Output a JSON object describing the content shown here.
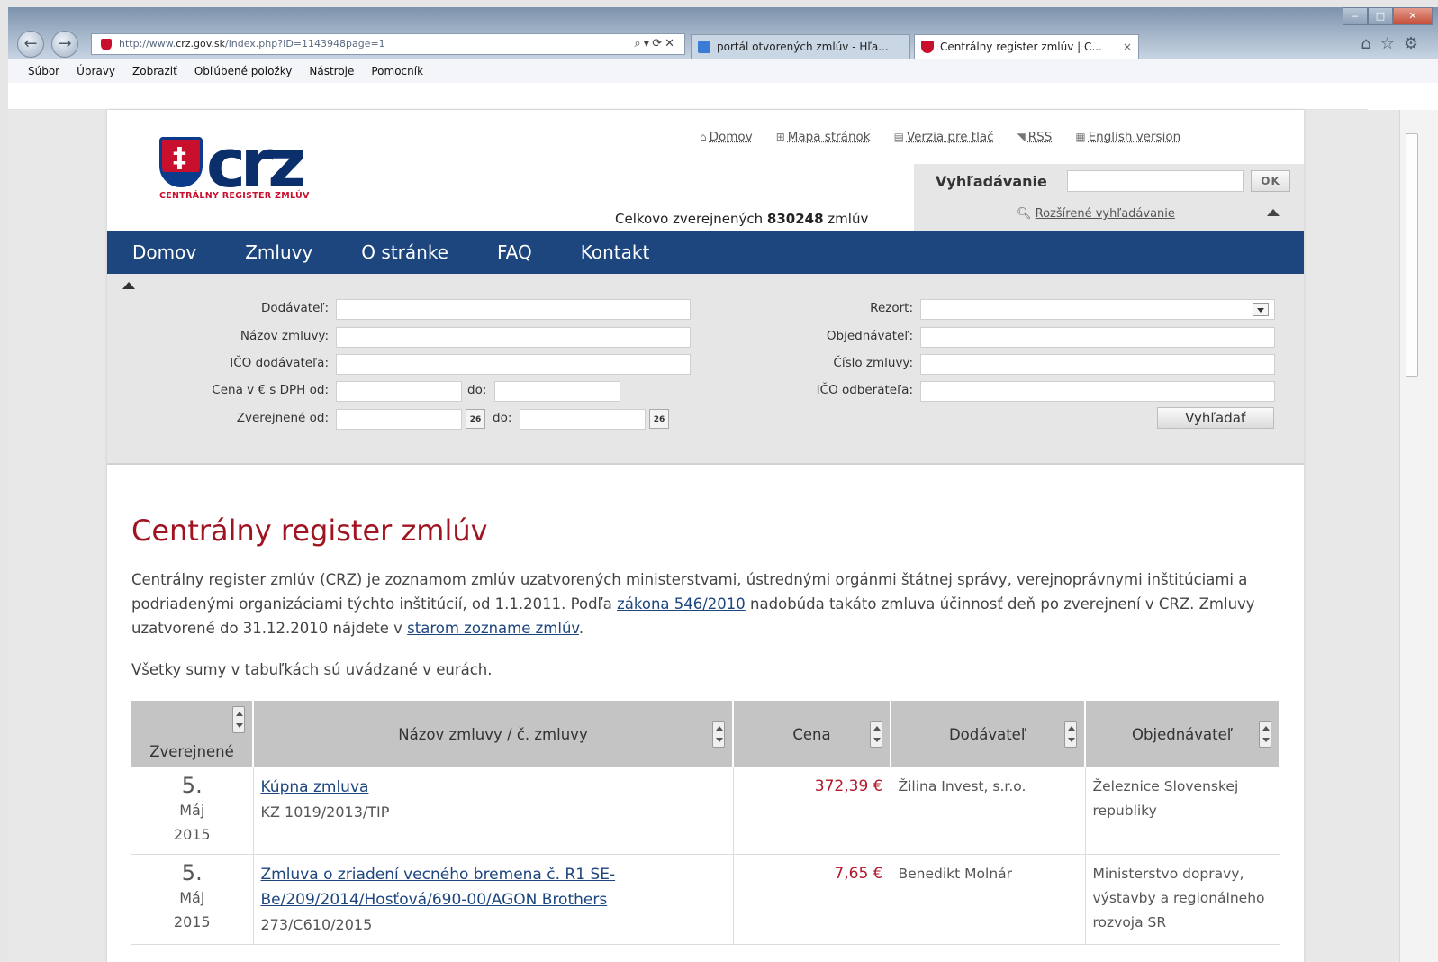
{
  "browser": {
    "address": "http://www.crz.gov.sk/index.php?ID=1143948page=1",
    "address_prefix": "http://www.",
    "address_domain": "crz.gov.sk",
    "address_rest": "/index.php?ID=1143948page=1",
    "tabs": [
      {
        "label": "portál otvorených zmlúv - Hľa..."
      },
      {
        "label": "Centrálny register zmlúv | C..."
      }
    ],
    "menu": [
      "Súbor",
      "Úpravy",
      "Zobraziť",
      "Obľúbené položky",
      "Nástroje",
      "Pomocník"
    ]
  },
  "header": {
    "logo_text": "crz",
    "logo_tagline": "CENTRÁLNY REGISTER ZMLÚV",
    "top_links": [
      {
        "icon": "home-icon",
        "label": "Domov"
      },
      {
        "icon": "sitemap-icon",
        "label": "Mapa stránok"
      },
      {
        "icon": "printer-icon",
        "label": "Verzia pre tlač"
      },
      {
        "icon": "rss-icon",
        "label": "RSS"
      },
      {
        "icon": "flag-icon",
        "label": "English version"
      }
    ],
    "total_prefix": "Celkovo zverejnených",
    "total_count": "830248",
    "total_suffix": "zmlúv",
    "search_label": "Vyhľadávanie",
    "search_ok": "OK",
    "advanced_search": "Rozšírené vyhľadávanie"
  },
  "nav": [
    "Domov",
    "Zmluvy",
    "O stránke",
    "FAQ",
    "Kontakt"
  ],
  "filter": {
    "supplier": "Dodávateľ:",
    "contract_name": "Názov zmluvy:",
    "supplier_ico": "IČO dodávateľa:",
    "price_from": "Cena v € s DPH od:",
    "published_from": "Zverejnené od:",
    "to": "do:",
    "calendar_day": "26",
    "department": "Rezort:",
    "orderer": "Objednávateľ:",
    "contract_number": "Číslo zmluvy:",
    "buyer_ico": "IČO odberateľa:",
    "search_button": "Vyhľadať"
  },
  "content": {
    "title": "Centrálny register zmlúv",
    "intro_1": "Centrálny register zmlúv (CRZ) je zoznamom zmlúv uzatvorených ministerstvami, ústrednými orgánmi štátnej správy, verejnoprávnymi inštitúciami a podriadenými organizáciami týchto inštitúcií, od 1.1.2011. Podľa ",
    "intro_link_1": "zákona 546/2010",
    "intro_2": " nadobúda takáto zmluva účinnosť deň po zverejnení v CRZ. Zmluvy uzatvorené do 31.12.2010 nájdete v ",
    "intro_link_2": "starom zozname zmlúv",
    "intro_3": ".",
    "note": "Všetky sumy v tabuľkách sú uvádzané v eurách."
  },
  "table": {
    "headers": [
      "Zverejnené",
      "Názov zmluvy / č. zmluvy",
      "Cena",
      "Dodávateľ",
      "Objednávateľ"
    ],
    "rows": [
      {
        "day": "5.",
        "month": "Máj",
        "year": "2015",
        "title": "Kúpna zmluva",
        "number": "KZ 1019/2013/TIP",
        "price": "372,39 €",
        "supplier": "Žilina Invest, s.r.o.",
        "orderer": "Železnice Slovenskej republiky"
      },
      {
        "day": "5.",
        "month": "Máj",
        "year": "2015",
        "title": "Zmluva o zriadení vecného bremena č. R1 SE-Be/209/2014/Hosťová/690-00/AGON Brothers",
        "number": "273/C610/2015",
        "price": "7,65 €",
        "supplier": "Benedikt Molnár",
        "orderer": "Ministerstvo dopravy, výstavby a regionálneho rozvoja SR"
      }
    ]
  }
}
